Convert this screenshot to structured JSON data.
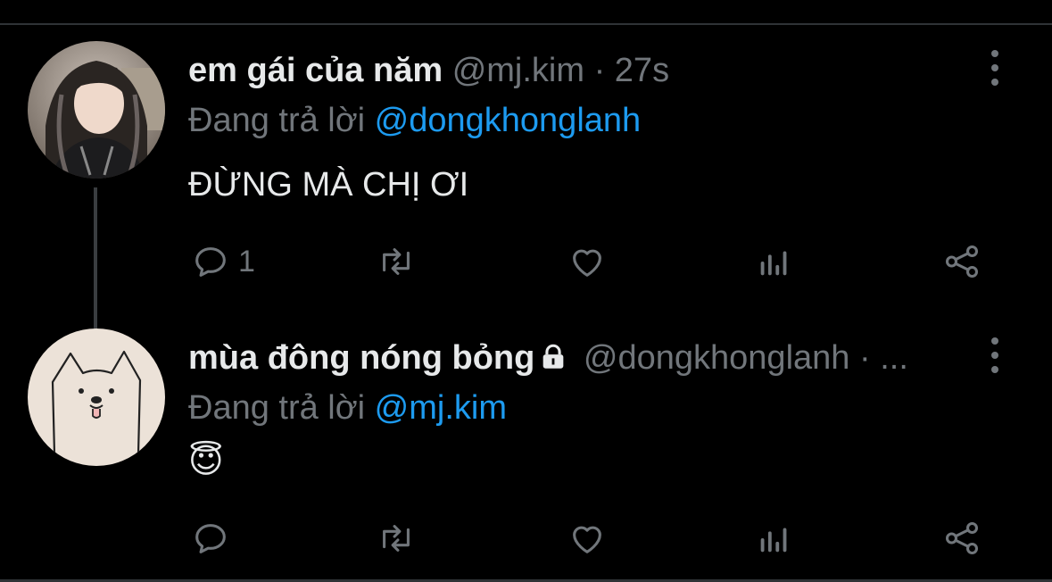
{
  "tweets": [
    {
      "name": "em gái của năm",
      "handle": "@mj.kim",
      "separator": "·",
      "time": "27s",
      "reply_prefix": "Đang trả lời",
      "reply_to": "@dongkhonglanh",
      "text": "ĐỪNG MÀ CHỊ ƠI",
      "reply_count": "1",
      "avatar": "girl-photo-avatar"
    },
    {
      "name": "mùa đông nóng bỏng",
      "handle": "@dongkhonglanh",
      "separator": "·",
      "time": "...",
      "reply_prefix": "Đang trả lời",
      "reply_to": "@mj.kim",
      "text": "😇",
      "reply_count": "",
      "avatar": "dog-drawing-avatar",
      "locked": true
    }
  ],
  "colors": {
    "background": "#000000",
    "primary_text": "#e7e9ea",
    "secondary_text": "#71767b",
    "accent": "#1d9bf0"
  },
  "icons": [
    "reply-icon",
    "retweet-icon",
    "like-icon",
    "views-icon",
    "share-icon",
    "more-icon",
    "lock-icon"
  ]
}
